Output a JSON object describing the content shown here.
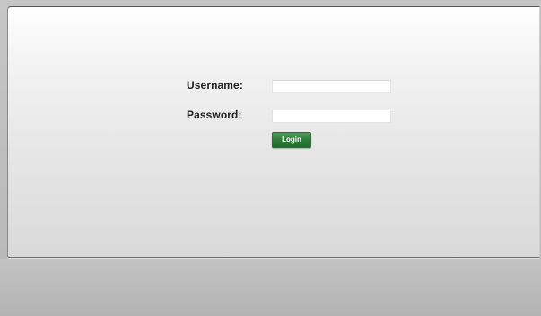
{
  "login_form": {
    "username_label": "Username:",
    "username_value": "",
    "password_label": "Password:",
    "password_value": "",
    "login_button_label": "Login"
  },
  "colors": {
    "login_button": "#2f7d3b",
    "panel_background": "#ececec",
    "page_background": "#bdbdbd"
  }
}
